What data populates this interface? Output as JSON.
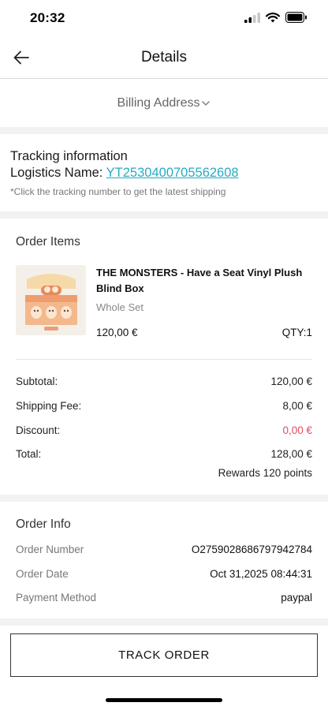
{
  "status_bar": {
    "time": "20:32"
  },
  "header": {
    "title": "Details"
  },
  "billing": {
    "label": "Billing Address"
  },
  "tracking": {
    "title": "Tracking information",
    "logistics_label": "Logistics Name: ",
    "tracking_number": "YT2530400705562608",
    "hint": "*Click the tracking number to get the latest shipping"
  },
  "order_items": {
    "title": "Order Items",
    "product": {
      "name": "THE MONSTERS - Have a Seat Vinyl Plush Blind Box",
      "variant": "Whole Set",
      "price": "120,00 €",
      "qty": "QTY:1"
    },
    "summary": {
      "subtotal_label": "Subtotal:",
      "subtotal": "120,00 €",
      "shipping_label": "Shipping Fee:",
      "shipping": "8,00 €",
      "discount_label": "Discount:",
      "discount": "0,00 €",
      "total_label": "Total:",
      "total": "128,00 €",
      "rewards": "Rewards 120 points"
    }
  },
  "order_info": {
    "title": "Order Info",
    "number_label": "Order Number",
    "number": "O2759028686797942784",
    "date_label": "Order Date",
    "date": "Oct 31,2025 08:44:31",
    "payment_label": "Payment Method",
    "payment": "paypal"
  },
  "actions": {
    "track_order": "TRACK ORDER"
  },
  "colors": {
    "link": "#29a9c4",
    "discount": "#e04a62",
    "section_gap": "#f2f2f2"
  },
  "icons": {
    "back": "arrow-left-icon",
    "chevron": "chevron-down-icon",
    "signal": "signal-icon",
    "wifi": "wifi-icon",
    "battery": "battery-icon"
  }
}
